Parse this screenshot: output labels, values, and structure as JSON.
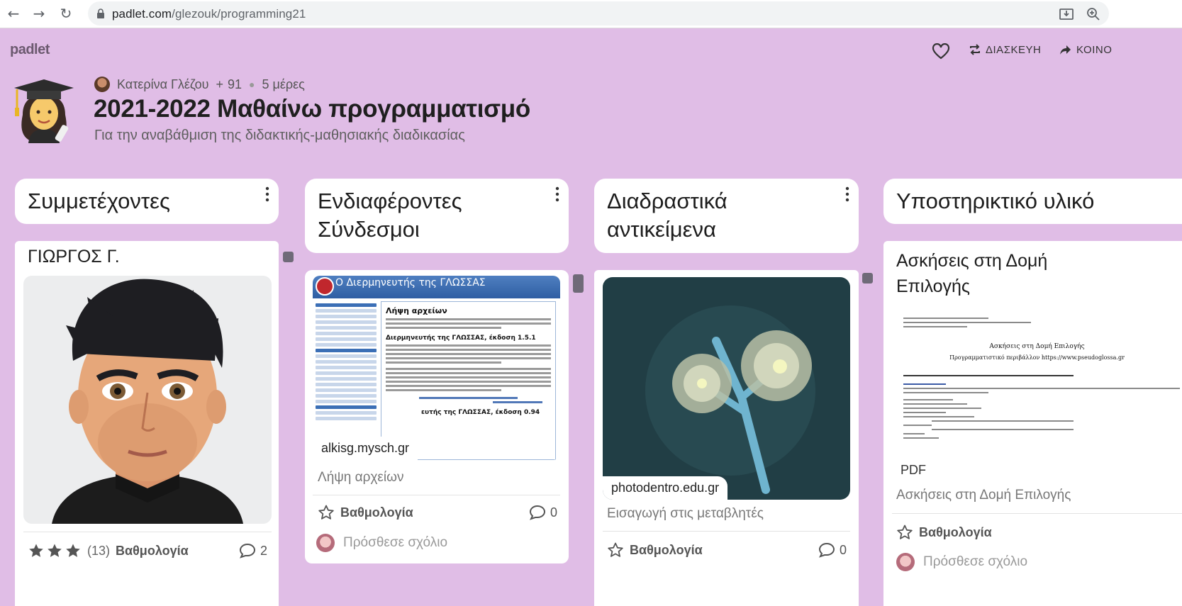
{
  "browser": {
    "url_host": "padlet.com",
    "url_path": "/glezouk/programming21"
  },
  "header": {
    "logo": "padlet",
    "remix_label": "ΔΙΑΣΚΕΥΗ",
    "share_label": "ΚΟΙΝΟ"
  },
  "board": {
    "author": "Κατερίνα Γλέζου",
    "plus": "+",
    "contributors": "91",
    "age": "5 μέρες",
    "title": "2021-2022 Μαθαίνω προγραμματισμό",
    "subtitle": "Για την αναβάθμιση της διδακτικής-μαθησιακής διαδικασίας"
  },
  "columns": [
    {
      "title": "Συμμετέχοντες",
      "card": {
        "title": "ΓΙΩΡΓΟΣ Γ.",
        "rating_count": "(13)",
        "rating_label": "Βαθμολογία",
        "filled_stars": 3,
        "comments": "2"
      }
    },
    {
      "title_line1": "Ενδιαφέροντες",
      "title_line2": "Σύνδεσμοι",
      "card": {
        "link_host": "alkisg.mysch.gr",
        "caption": "Λήψη αρχείων",
        "rating_label": "Βαθμολογία",
        "comments": "0",
        "add_comment": "Πρόσθεσε σχόλιο",
        "site": {
          "banner": "Ο Διερμηνευτής της ΓΛΩΣΣΑΣ",
          "heading": "Λήψη αρχείων",
          "sub1": "Διερμηνευτής της ΓΛΩΣΣΑΣ, έκδοση 1.5.1",
          "sub2": "ευτής της ΓΛΩΣΣΑΣ, έκδοση 0.94"
        }
      }
    },
    {
      "title_line1": "Διαδραστικά",
      "title_line2": "αντικείμενα",
      "card": {
        "link_host": "photodentro.edu.gr",
        "caption": "Εισαγωγή στις μεταβλητές",
        "rating_label": "Βαθμολογία",
        "comments": "0"
      }
    },
    {
      "title": "Υποστηρικτικό υλικό",
      "card": {
        "title_line1": "Ασκήσεις στη Δομή",
        "title_line2": "Επιλογής",
        "badge": "PDF",
        "caption": "Ασκήσεις στη Δομή Επιλογής",
        "rating_label": "Βαθμολογία",
        "add_comment": "Πρόσθεσε σχόλιο",
        "doc": {
          "heading": "Ασκήσεις στη Δομή Επιλογής",
          "line": "Προγραμματιστικό περιβάλλον https://www.pseudoglossa.gr"
        }
      }
    }
  ],
  "colors": {
    "background": "#e0bde6",
    "card": "#ffffff",
    "star_filled": "#555555"
  }
}
